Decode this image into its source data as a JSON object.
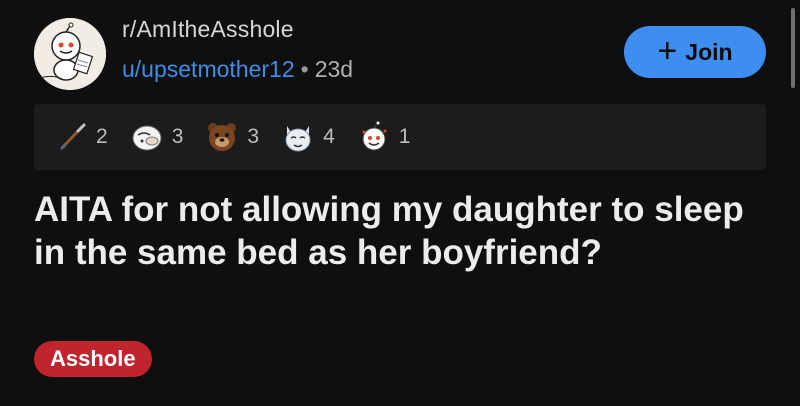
{
  "post": {
    "subreddit": "r/AmItheAsshole",
    "author": "u/upsetmother12",
    "separator": "•",
    "age": "23d",
    "join_button": {
      "plus": "+",
      "label": "Join"
    },
    "awards": [
      {
        "icon": "paintbrush-award-icon",
        "count": "2"
      },
      {
        "icon": "facepalm-award-icon",
        "count": "3"
      },
      {
        "icon": "bear-award-icon",
        "count": "3"
      },
      {
        "icon": "wolf-award-icon",
        "count": "4"
      },
      {
        "icon": "snoo-award-icon",
        "count": "1"
      }
    ],
    "title": "AITA for not allowing my daughter to sleep in the same bed as her boyfriend?",
    "flair": {
      "label": "Asshole",
      "color": "#c0242c"
    }
  },
  "colors": {
    "background": "#0f0f0f",
    "accent_link": "#3c8ee6",
    "join_button": "#3d8ef0",
    "award_bar": "#1c1c1c"
  }
}
